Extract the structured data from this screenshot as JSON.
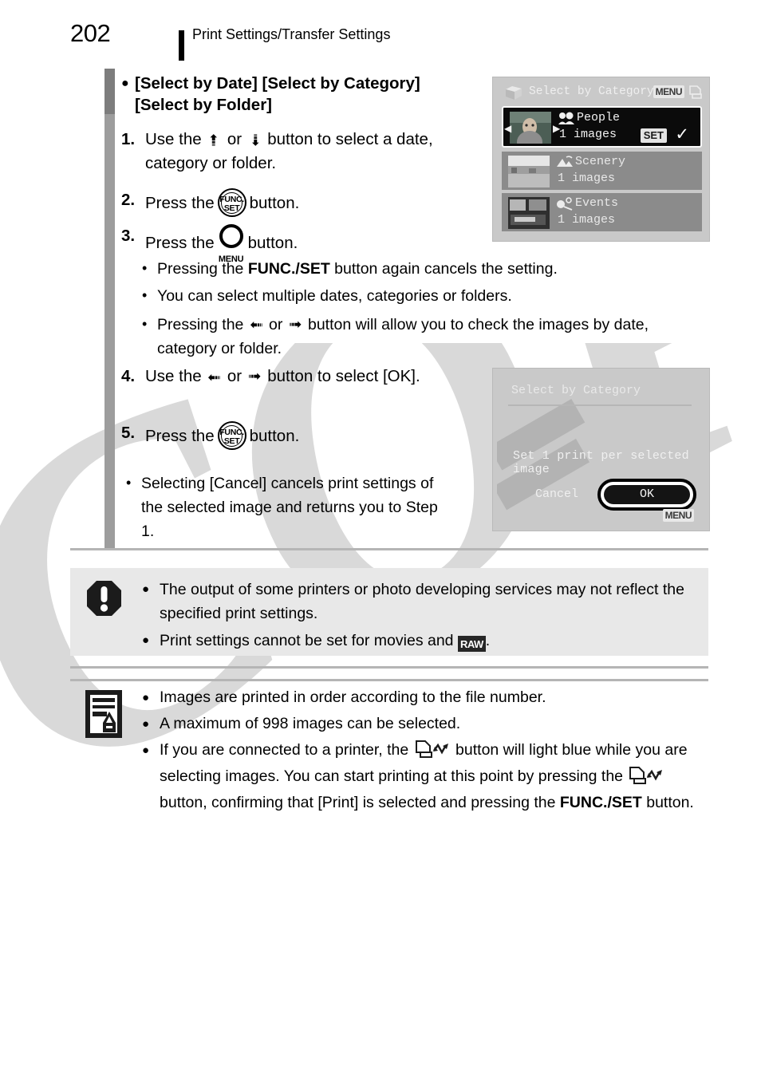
{
  "header": {
    "page_number": "202",
    "title": "Print Settings/Transfer Settings"
  },
  "section": {
    "heading": "[Select by Date] [Select by Category] [Select by Folder]",
    "steps": [
      {
        "num": "1.",
        "pre": "Use the",
        "mid": "or",
        "post": "button to select a date, category or folder.",
        "icon1": "up-arrow",
        "icon2": "down-arrow"
      },
      {
        "num": "2.",
        "pre": "Press the",
        "post": "button.",
        "icon1": "func-set-button"
      },
      {
        "num": "3.",
        "pre": "Press the",
        "post": "button.",
        "icon1": "menu-button"
      },
      {
        "num": "4.",
        "pre": "Use the",
        "mid": "or",
        "post": "button to select [OK].",
        "icon1": "left-arrow",
        "icon2": "right-arrow"
      },
      {
        "num": "5.",
        "pre": "Press the",
        "post": "button.",
        "icon1": "func-set-button"
      }
    ],
    "substeps": [
      {
        "pre": "Pressing the",
        "bold": "FUNC./SET",
        "post": "button again cancels the setting."
      },
      {
        "text": "You can select multiple dates, categories or folders."
      },
      {
        "pre": "Pressing the",
        "mid": "or",
        "post": "button will allow you to check the images by date, category or folder."
      }
    ],
    "cancel_note": "Selecting [Cancel] cancels print settings of the selected image and returns you to Step 1."
  },
  "lcd_category": {
    "title": "Select by Category",
    "menu_label": "MENU",
    "set_label": "SET",
    "check": "✓",
    "items": [
      {
        "name": "People",
        "count": "1 images",
        "icon": "people-icon",
        "selected": true
      },
      {
        "name": "Scenery",
        "count": "1 images",
        "icon": "scenery-icon",
        "selected": false
      },
      {
        "name": "Events",
        "count": "1 images",
        "icon": "events-icon",
        "selected": false
      }
    ]
  },
  "lcd_confirm": {
    "title": "Select by Category",
    "message": "Set 1 print per selected image",
    "cancel_label": "Cancel",
    "ok_label": "OK",
    "menu_label": "MENU"
  },
  "warning": {
    "icon": "warning-exclamation-icon",
    "items": [
      {
        "text": "The output of some printers or photo developing services may not reflect the specified print settings."
      },
      {
        "pre": "Print settings cannot be set for movies and",
        "badge": "RAW",
        "post": "."
      }
    ]
  },
  "notes": {
    "icon": "note-pencil-icon",
    "items": [
      {
        "text": "Images are printed in order according to the file number."
      },
      {
        "text": "A maximum of 998 images can be selected."
      },
      {
        "seg1": "If you are connected to a printer, the",
        "seg2": "button will light blue while you are selecting images. You can start printing at this point by pressing the",
        "seg3": "button, confirming that [Print] is selected and pressing the",
        "bold": "FUNC./SET",
        "seg4": "button."
      }
    ]
  },
  "watermark": {
    "text": "COPY"
  },
  "colors": {
    "margin_bar_dark": "#7d7d7d",
    "margin_bar_light": "#9d9d9d",
    "warning_panel_bg": "#e8e8e8",
    "divider": "#b5b5b5",
    "lcd_bg": "#c9c9c9"
  }
}
